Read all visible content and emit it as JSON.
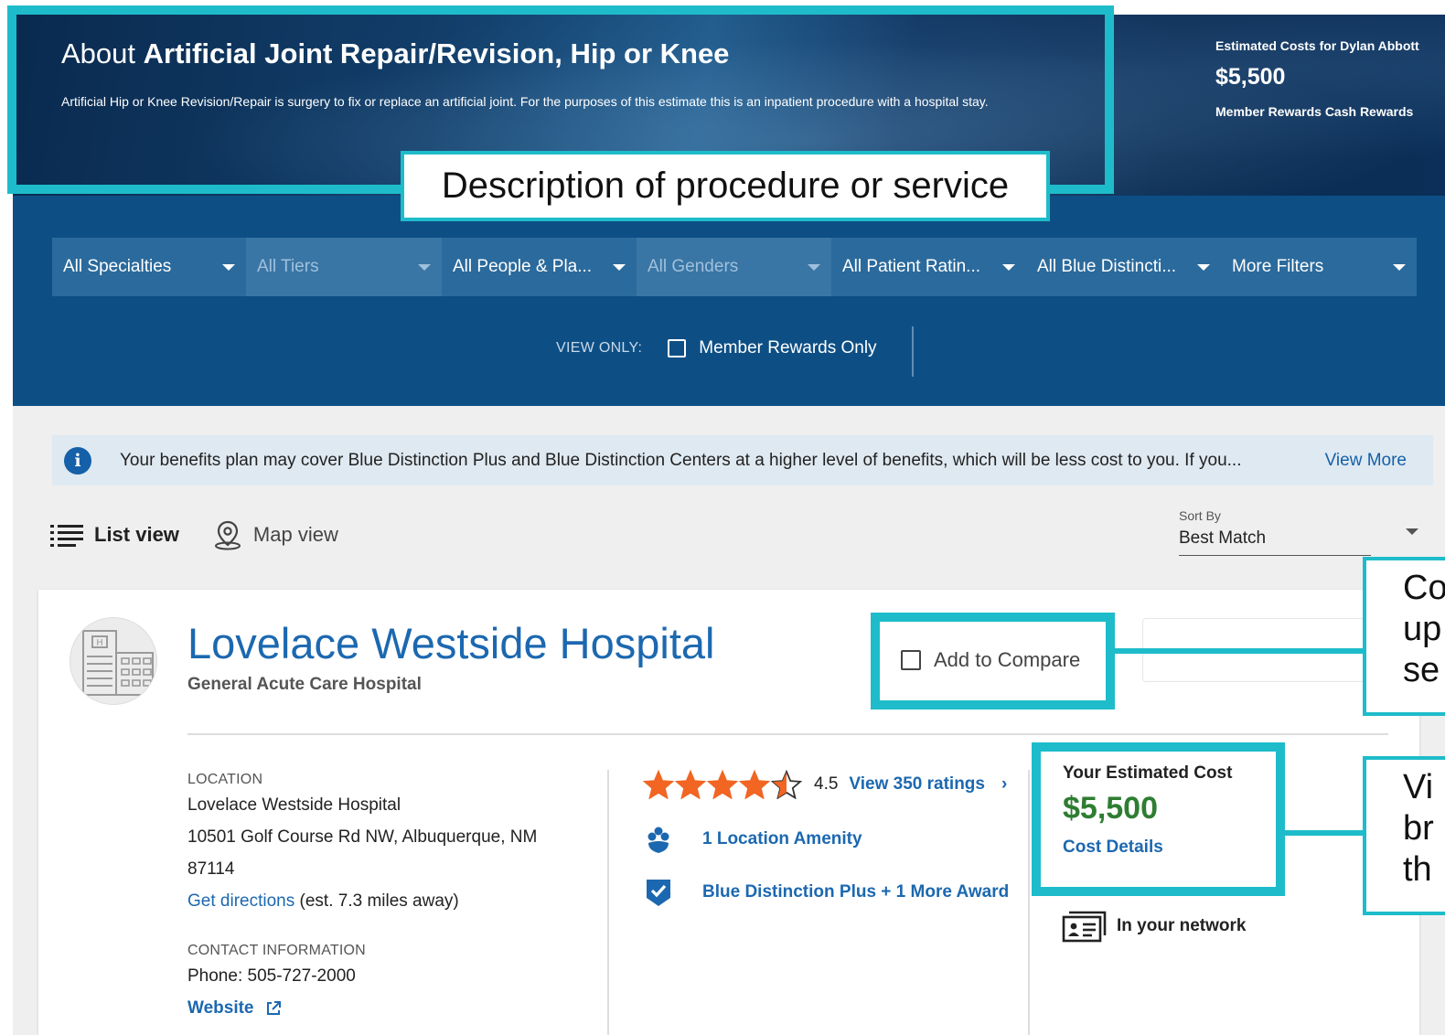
{
  "hero": {
    "title_prefix": "About ",
    "title_bold": "Artificial Joint Repair/Revision, Hip or Knee",
    "description": "Artificial Hip or Knee Revision/Repair is surgery to fix or replace an artificial joint. For the purposes of this estimate this is an inpatient procedure with a hospital stay.",
    "estimate": {
      "label": "Estimated Costs for Dylan Abbott",
      "amount": "$5,500",
      "rewards_label": "Member Rewards Cash Rewards"
    }
  },
  "annotations": {
    "description_callout": "Description of procedure or service",
    "compare_callout_lines": [
      "Co",
      "up",
      "se"
    ],
    "cost_callout_lines": [
      "Vi",
      "br",
      "th"
    ],
    "accent_color": "#1ebcca"
  },
  "filters": [
    {
      "label": "All Specialties",
      "state": "active"
    },
    {
      "label": "All Tiers",
      "state": "disabled"
    },
    {
      "label": "All People & Pla...",
      "state": "active"
    },
    {
      "label": "All Genders",
      "state": "disabled"
    },
    {
      "label": "All Patient Ratin...",
      "state": "active"
    },
    {
      "label": "All Blue Distincti...",
      "state": "active"
    },
    {
      "label": "More Filters",
      "state": "active"
    }
  ],
  "view_only": {
    "label": "VIEW ONLY:",
    "option": "Member Rewards Only",
    "checked": false
  },
  "info_bar": {
    "icon": "info-icon",
    "text": "Your benefits plan may cover Blue Distinction Plus and Blue Distinction Centers at a higher level of benefits, which will be less cost to you. If you...",
    "link": "View More"
  },
  "view_toggle": {
    "list_label": "List view",
    "map_label": "Map view",
    "selected": "list"
  },
  "sort": {
    "label": "Sort By",
    "value": "Best Match"
  },
  "result": {
    "name": "Lovelace Westside Hospital",
    "type": "General Acute Care Hospital",
    "compare_label": "Add to Compare",
    "location": {
      "heading": "LOCATION",
      "name": "Lovelace Westside Hospital",
      "address_line1": "10501 Golf Course Rd NW, Albuquerque, NM",
      "address_line2": "87114",
      "directions_link": "Get directions",
      "distance": "(est. 7.3 miles away)"
    },
    "contact": {
      "heading": "CONTACT INFORMATION",
      "phone": "Phone: 505-727-2000",
      "website": "Website"
    },
    "rating": {
      "value": "4.5",
      "stars": 4.5,
      "max_stars": 5,
      "link": "View 350 ratings",
      "star_color": "#f26522"
    },
    "amenity": "1 Location Amenity",
    "award": "Blue Distinction Plus + 1 More Award",
    "cost": {
      "label": "Your Estimated Cost",
      "amount": "$5,500",
      "details_link": "Cost Details"
    },
    "network": "In your network"
  }
}
